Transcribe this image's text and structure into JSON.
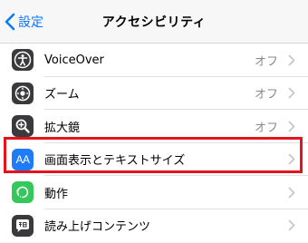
{
  "nav": {
    "back_label": "設定",
    "title": "アクセシビリティ"
  },
  "rows": [
    {
      "label": "VoiceOver",
      "value": "オフ",
      "icon": "voiceover-icon"
    },
    {
      "label": "ズーム",
      "value": "オフ",
      "icon": "zoom-icon"
    },
    {
      "label": "拡大鏡",
      "value": "オフ",
      "icon": "magnifier-icon"
    },
    {
      "label": "画面表示とテキストサイズ",
      "value": "",
      "icon": "display-text-size-icon",
      "icon_text": "AA",
      "highlighted": true
    },
    {
      "label": "動作",
      "value": "",
      "icon": "motion-icon"
    },
    {
      "label": "読み上げコンテンツ",
      "value": "",
      "icon": "spoken-content-icon"
    }
  ],
  "colors": {
    "accent": "#0a7aff",
    "highlight_border": "#e3141e",
    "icon_dark": "#3a3a3c",
    "icon_blue": "#1f7cf7",
    "icon_green": "#34c759"
  }
}
